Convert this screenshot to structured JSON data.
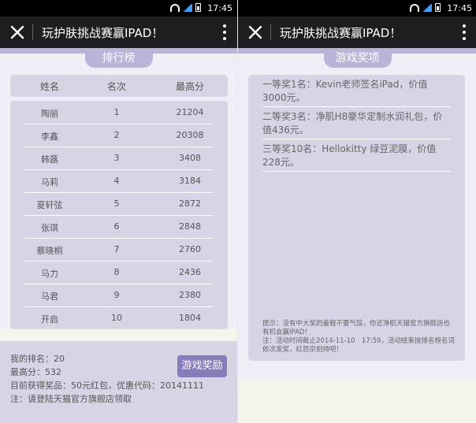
{
  "status_bar": {
    "time": "17:45"
  },
  "app": {
    "title": "玩护肤挑战赛赢IPAD！"
  },
  "leaderboard": {
    "tab_label": "排行榜",
    "columns": [
      "姓名",
      "名次",
      "最高分"
    ],
    "rows": [
      {
        "name": "陶丽",
        "rank": "1",
        "score": "21204"
      },
      {
        "name": "李鑫",
        "rank": "2",
        "score": "20308"
      },
      {
        "name": "韩蕗",
        "rank": "3",
        "score": "3408"
      },
      {
        "name": "马莉",
        "rank": "4",
        "score": "3184"
      },
      {
        "name": "夏轩弦",
        "rank": "5",
        "score": "2872"
      },
      {
        "name": "张琪",
        "rank": "6",
        "score": "2848"
      },
      {
        "name": "蔡晓桐",
        "rank": "7",
        "score": "2760"
      },
      {
        "name": "马力",
        "rank": "8",
        "score": "2436"
      },
      {
        "name": "马君",
        "rank": "9",
        "score": "2380"
      },
      {
        "name": "开启",
        "rank": "10",
        "score": "1804"
      }
    ],
    "my_rank": "我的排名：20",
    "best_score": "最高分：532",
    "reward": "目前获得奖品：50元红包，优惠代码：20141111",
    "note": "注：请登陆天猫官方旗舰店领取",
    "prize_button": "游戏奖励"
  },
  "prizes": {
    "tab_label": "游戏奖项",
    "items": [
      "一等奖1名：Kevin老师签名iPad，价值3000元。",
      "二等奖3名：净肌H8豪华定制水润礼包，价值436元。",
      "三等奖10名：Hellokitty 绿豆泥膜，价值228元。"
    ],
    "note_1": "提示：没有中大奖的童鞋不要气馁，你还净肌天猫官方旗舰店也有机会赢IPAD！",
    "note_2": "注：活动时间截止2014-11-10　17:59，活动结束按排名榜名词依次发奖，红恐宗刻持吧！"
  }
}
